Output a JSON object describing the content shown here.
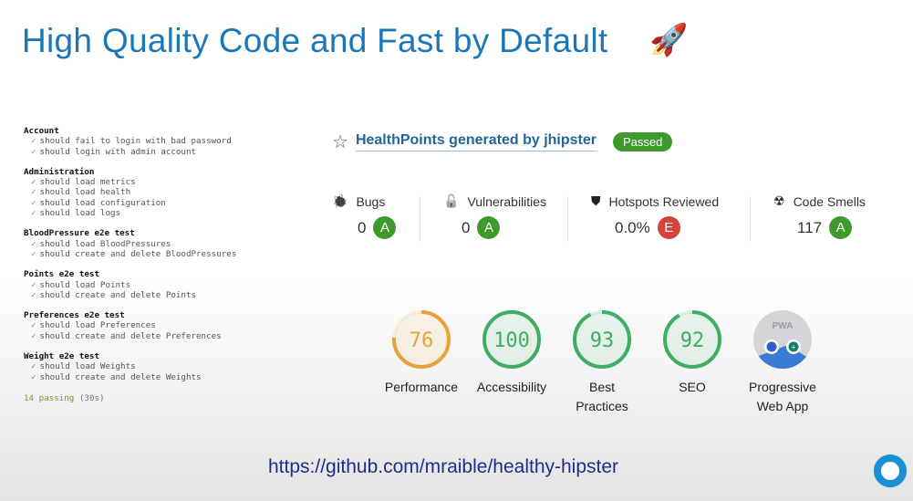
{
  "title": "High Quality Code and Fast by Default",
  "title_emoji": "🚀",
  "tests": {
    "suites": [
      {
        "name": "Account",
        "tests": [
          "should fail to login with bad password",
          "should login with admin account"
        ]
      },
      {
        "name": "Administration",
        "tests": [
          "should load metrics",
          "should load health",
          "should load configuration",
          "should load logs"
        ]
      },
      {
        "name": "BloodPressure e2e test",
        "tests": [
          "should load BloodPressures",
          "should create and delete BloodPressures"
        ]
      },
      {
        "name": "Points e2e test",
        "tests": [
          "should load Points",
          "should create and delete Points"
        ]
      },
      {
        "name": "Preferences e2e test",
        "tests": [
          "should load Preferences",
          "should create and delete Preferences"
        ]
      },
      {
        "name": "Weight e2e test",
        "tests": [
          "should load Weights",
          "should create and delete Weights"
        ]
      }
    ],
    "passing": "14 passing",
    "duration": "(30s)"
  },
  "sonar": {
    "project": "HealthPoints generated by jhipster",
    "status": "Passed",
    "metrics": [
      {
        "label": "Bugs",
        "value": "0",
        "grade": "A",
        "icon": "bug-icon"
      },
      {
        "label": "Vulnerabilities",
        "value": "0",
        "grade": "A",
        "icon": "lock-icon"
      },
      {
        "label": "Hotspots Reviewed",
        "value": "0.0%",
        "grade": "E",
        "icon": "shield-icon"
      },
      {
        "label": "Code Smells",
        "value": "117",
        "grade": "A",
        "icon": "radiation-icon"
      }
    ],
    "colors": {
      "A": "#3f9a2e",
      "E": "#d4433a"
    }
  },
  "lighthouse": [
    {
      "label1": "Performance",
      "label2": "",
      "score": 76,
      "color": "#e8a23a"
    },
    {
      "label1": "Accessibility",
      "label2": "",
      "score": 100,
      "color": "#3fad64"
    },
    {
      "label1": "Best",
      "label2": "Practices",
      "score": 93,
      "color": "#3fad64"
    },
    {
      "label1": "SEO",
      "label2": "",
      "score": 92,
      "color": "#3fad64"
    },
    {
      "label1": "Progressive",
      "label2": "Web App",
      "pwa": "PWA"
    }
  ],
  "url": "https://github.com/mraible/healthy-hipster"
}
